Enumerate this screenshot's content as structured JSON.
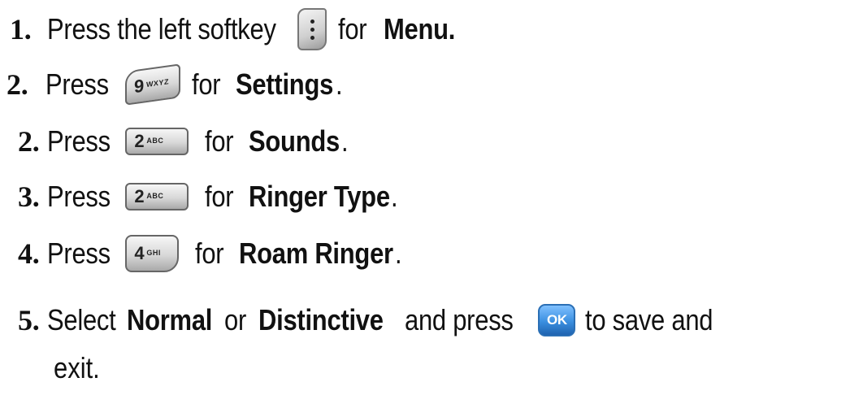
{
  "steps": [
    {
      "num": "1.",
      "pre": "Press the left softkey",
      "post": "for",
      "bold": "Menu.",
      "tail": "",
      "key": "softkey"
    },
    {
      "num": "2.",
      "pre": "Press",
      "post": "for",
      "bold": "Settings",
      "tail": ".",
      "key": {
        "digit": "9",
        "letters": "WXYZ"
      }
    },
    {
      "num": "2.",
      "pre": "Press",
      "post": "for",
      "bold": "Sounds",
      "tail": ".",
      "key": {
        "digit": "2",
        "letters": "ABC"
      }
    },
    {
      "num": "3.",
      "pre": "Press",
      "post": "for",
      "bold": "Ringer Type",
      "tail": ".",
      "key": {
        "digit": "2",
        "letters": "ABC"
      }
    },
    {
      "num": "4.",
      "pre": "Press",
      "post": "for",
      "bold": "Roam Ringer",
      "tail": ".",
      "key": {
        "digit": "4",
        "letters": "GHI"
      }
    }
  ],
  "step5": {
    "num": "5.",
    "a": "Select",
    "opt1": "Normal",
    "or": "or",
    "opt2": "Distinctive",
    "and": "and press",
    "key_label": "OK",
    "post": "to save and",
    "wrap": "exit."
  },
  "colors": {
    "ok_key": "#3b8fe0",
    "text": "#111111"
  }
}
